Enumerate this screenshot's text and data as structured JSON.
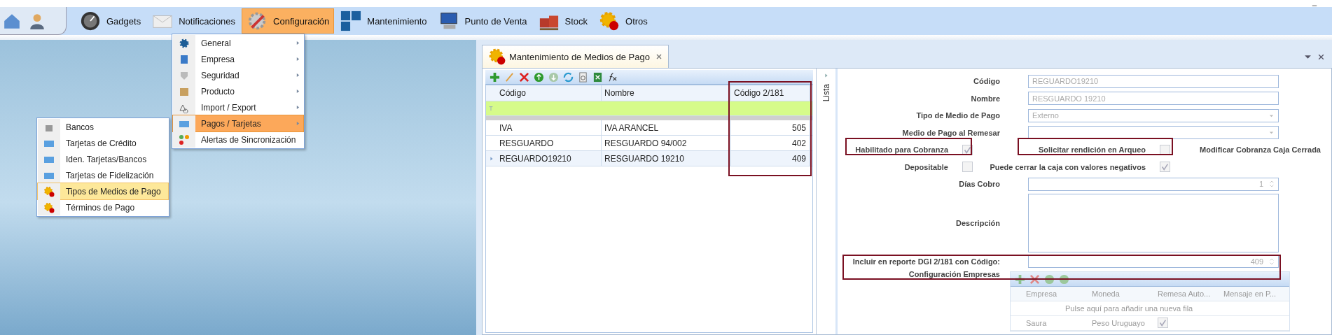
{
  "ribbon": {
    "items": [
      {
        "label": "Gadgets",
        "selected": false
      },
      {
        "label": "Notificaciones",
        "selected": false
      },
      {
        "label": "Configuración",
        "selected": true
      },
      {
        "label": "Mantenimiento",
        "selected": false
      },
      {
        "label": "Punto de Venta",
        "selected": false
      },
      {
        "label": "Stock",
        "selected": false
      },
      {
        "label": "Otros",
        "selected": false
      }
    ]
  },
  "menu": {
    "items": [
      {
        "label": "General",
        "selected": false,
        "submenu": true
      },
      {
        "label": "Empresa",
        "selected": false,
        "submenu": true
      },
      {
        "label": "Seguridad",
        "selected": false,
        "submenu": true
      },
      {
        "label": "Producto",
        "selected": false,
        "submenu": true
      },
      {
        "label": "Import / Export",
        "selected": false,
        "submenu": true
      },
      {
        "label": "Pagos / Tarjetas",
        "selected": true,
        "submenu": true
      },
      {
        "label": "Alertas de Sincronización",
        "selected": false,
        "submenu": false
      }
    ]
  },
  "submenu": {
    "items": [
      {
        "label": "Bancos",
        "selected": false
      },
      {
        "label": "Tarjetas de Crédito",
        "selected": false
      },
      {
        "label": "Iden. Tarjetas/Bancos",
        "selected": false
      },
      {
        "label": "Tarjetas de Fidelización",
        "selected": false
      },
      {
        "label": "Tipos de Medios de Pago",
        "selected": true
      },
      {
        "label": "Términos de Pago",
        "selected": false
      }
    ]
  },
  "tab": {
    "title": "Mantenimiento de Medios de Pago"
  },
  "grid": {
    "columns": [
      "Código",
      "Nombre",
      "Código 2/181"
    ],
    "rows": [
      {
        "cells": [
          "IVA",
          "IVA ARANCEL",
          "505"
        ],
        "current": false
      },
      {
        "cells": [
          "RESGUARDO",
          "RESGUARDO 94/002",
          "402"
        ],
        "current": false
      },
      {
        "cells": [
          "REGUARDO19210",
          "RESGUARDO 19210",
          "409"
        ],
        "current": true
      }
    ]
  },
  "side_strip": {
    "label": "Lista"
  },
  "form": {
    "fields": [
      {
        "label": "Código",
        "kind": "text",
        "value": "REGUARDO19210"
      },
      {
        "label": "Nombre",
        "kind": "text",
        "value": "RESGUARDO 19210"
      },
      {
        "label": "Tipo de Medio de Pago",
        "kind": "combo",
        "value": "Externo"
      },
      {
        "label": "Medio de Pago al Remesar",
        "kind": "combo"
      }
    ],
    "checkbox_rows": [
      [
        {
          "label": "Habilitado para Cobranza",
          "checked": true
        },
        {
          "label": "Solicitar rendición en Arqueo",
          "checked": false
        },
        {
          "label": "Modificar Cobranza Caja Cerrada"
        }
      ],
      [
        {
          "label": "Depositable",
          "checked": false
        },
        {
          "label": "Puede cerrar la caja con valores negativos",
          "checked": true
        }
      ]
    ],
    "dias_cobro": {
      "label": "Días Cobro",
      "value": "1"
    },
    "descripcion": {
      "label": "Descripción"
    },
    "dgi": {
      "label": "Incluir en reporte DGI 2/181 con Código:",
      "value": "409"
    },
    "empresas": {
      "label": "Configuración Empresas",
      "columns": [
        "Empresa",
        "Moneda",
        "Remesa Auto...",
        "Mensaje en P..."
      ],
      "new_row_hint": "Pulse aquí para añadir una nueva fila",
      "rows": [
        {
          "cells": [
            "Saura",
            "Peso Uruguayo"
          ],
          "checked": true
        }
      ]
    }
  }
}
